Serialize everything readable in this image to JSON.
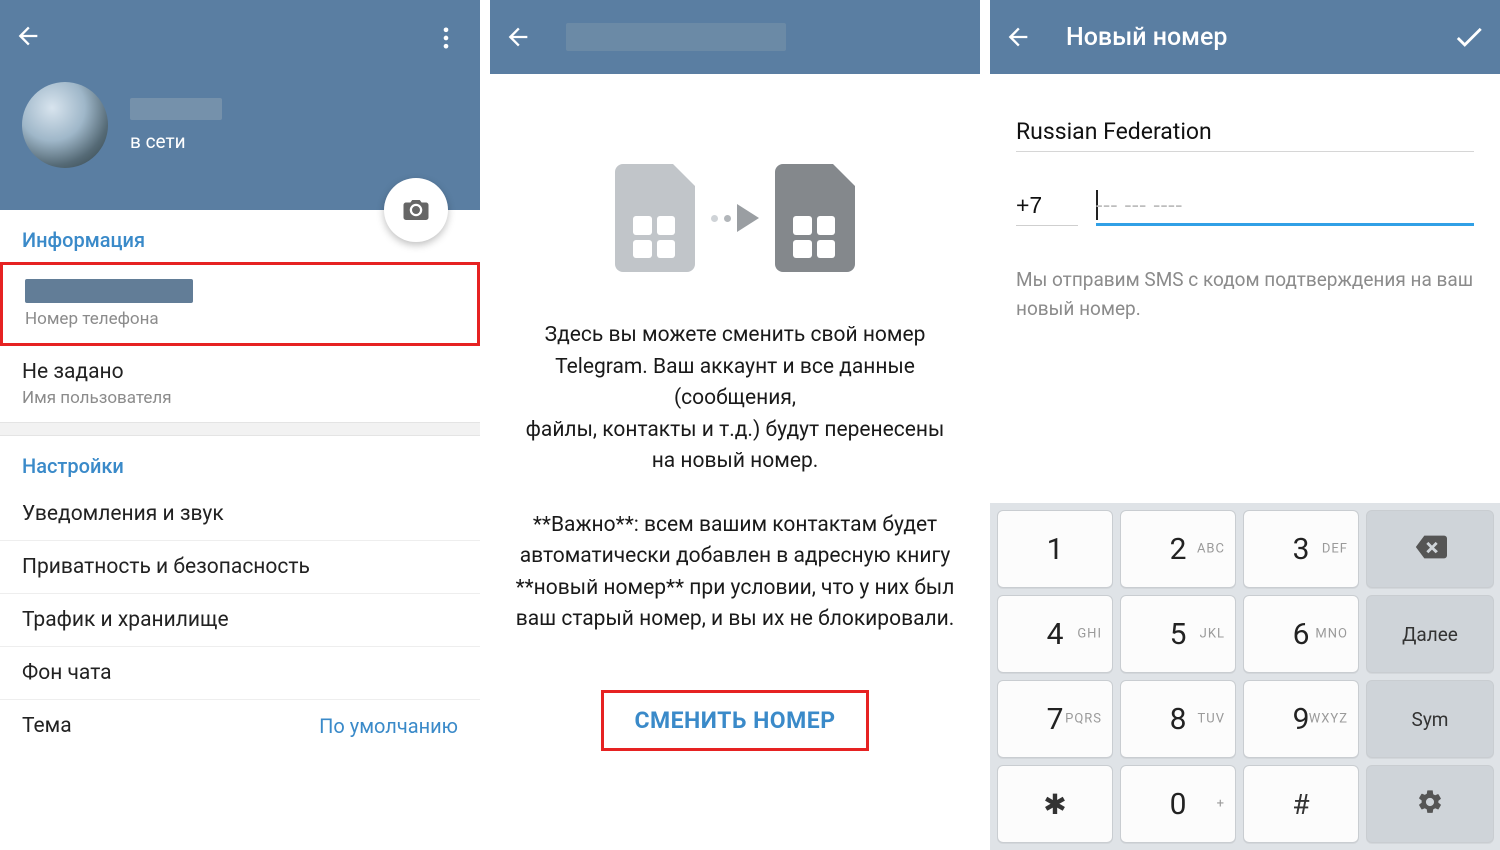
{
  "panel1": {
    "status": "в сети",
    "info_header": "Информация",
    "phone_label": "Номер телефона",
    "username_value": "Не задано",
    "username_label": "Имя пользователя",
    "settings_header": "Настройки",
    "items": {
      "notifications": "Уведомления и звук",
      "privacy": "Приватность и безопасность",
      "data": "Трафик и хранилище",
      "wallpaper": "Фон чата",
      "theme": "Тема",
      "theme_value": "По умолчанию"
    }
  },
  "panel2": {
    "para1": "Здесь вы можете сменить свой номер Telegram. Ваш аккаунт и все данные (сообщения,\nфайлы, контакты и т.д.) будут перенесены на новый номер.",
    "para2": "**Важно**: всем вашим контактам будет автоматически добавлен в адресную книгу **новый номер** при условии, что у них был ваш старый номер, и вы их не блокировали.",
    "button": "СМЕНИТЬ НОМЕР"
  },
  "panel3": {
    "title": "Новый номер",
    "country": "Russian Federation",
    "code": "+7",
    "placeholder": "--- --- ----",
    "hint": "Мы отправим SMS с кодом подтверждения на ваш новый номер."
  },
  "keypad": {
    "rows": [
      [
        {
          "d": "1",
          "l": ""
        },
        {
          "d": "2",
          "l": "ABC"
        },
        {
          "d": "3",
          "l": "DEF"
        }
      ],
      [
        {
          "d": "4",
          "l": "GHI"
        },
        {
          "d": "5",
          "l": "JKL"
        },
        {
          "d": "6",
          "l": "MNO"
        }
      ],
      [
        {
          "d": "7",
          "l": "PQRS"
        },
        {
          "d": "8",
          "l": "TUV"
        },
        {
          "d": "9",
          "l": "WXYZ"
        }
      ],
      [
        {
          "d": "✱",
          "l": ""
        },
        {
          "d": "0",
          "l": "+"
        },
        {
          "d": "#",
          "l": ""
        }
      ]
    ],
    "side": [
      "",
      "Далее",
      "Sym",
      ""
    ]
  }
}
